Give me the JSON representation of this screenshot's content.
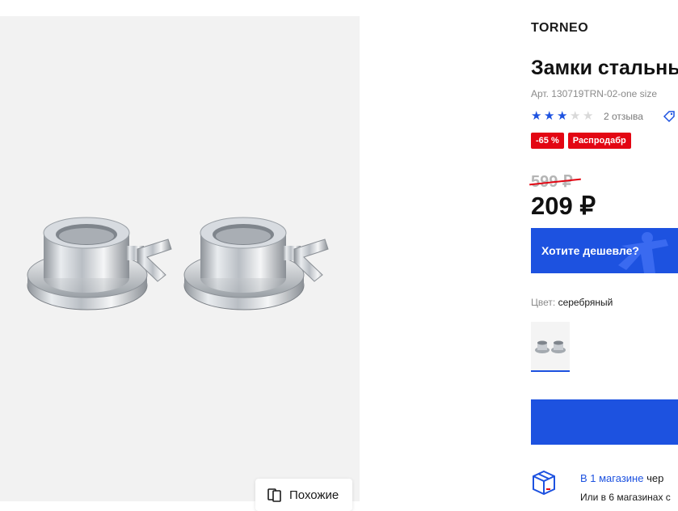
{
  "product": {
    "brand": "TORNEO",
    "title": "Замки стальны",
    "sku": "Арт. 130719TRN-02-one size",
    "rating": 3,
    "rating_max": 5,
    "reviews": "2 отзыва",
    "badges": [
      "-65 %",
      "Распродабр"
    ],
    "old_price": "599 ₽",
    "price": "209 ₽"
  },
  "gallery": {
    "similar_label": "Похожие"
  },
  "promo": {
    "cheaper_label": "Хотите дешевле?"
  },
  "color": {
    "key": "Цвет:",
    "value": "серебряный"
  },
  "availability": {
    "link": "В 1 магазине",
    "rest": " чер",
    "sub": "Или в 6 магазинах с"
  },
  "colors": {
    "accent": "#1d52e0",
    "sale": "#e30613",
    "gallery_bg": "#f2f2f2"
  },
  "icons": [
    "star-icon",
    "price-tag-icon",
    "similar-icon",
    "box-icon"
  ]
}
